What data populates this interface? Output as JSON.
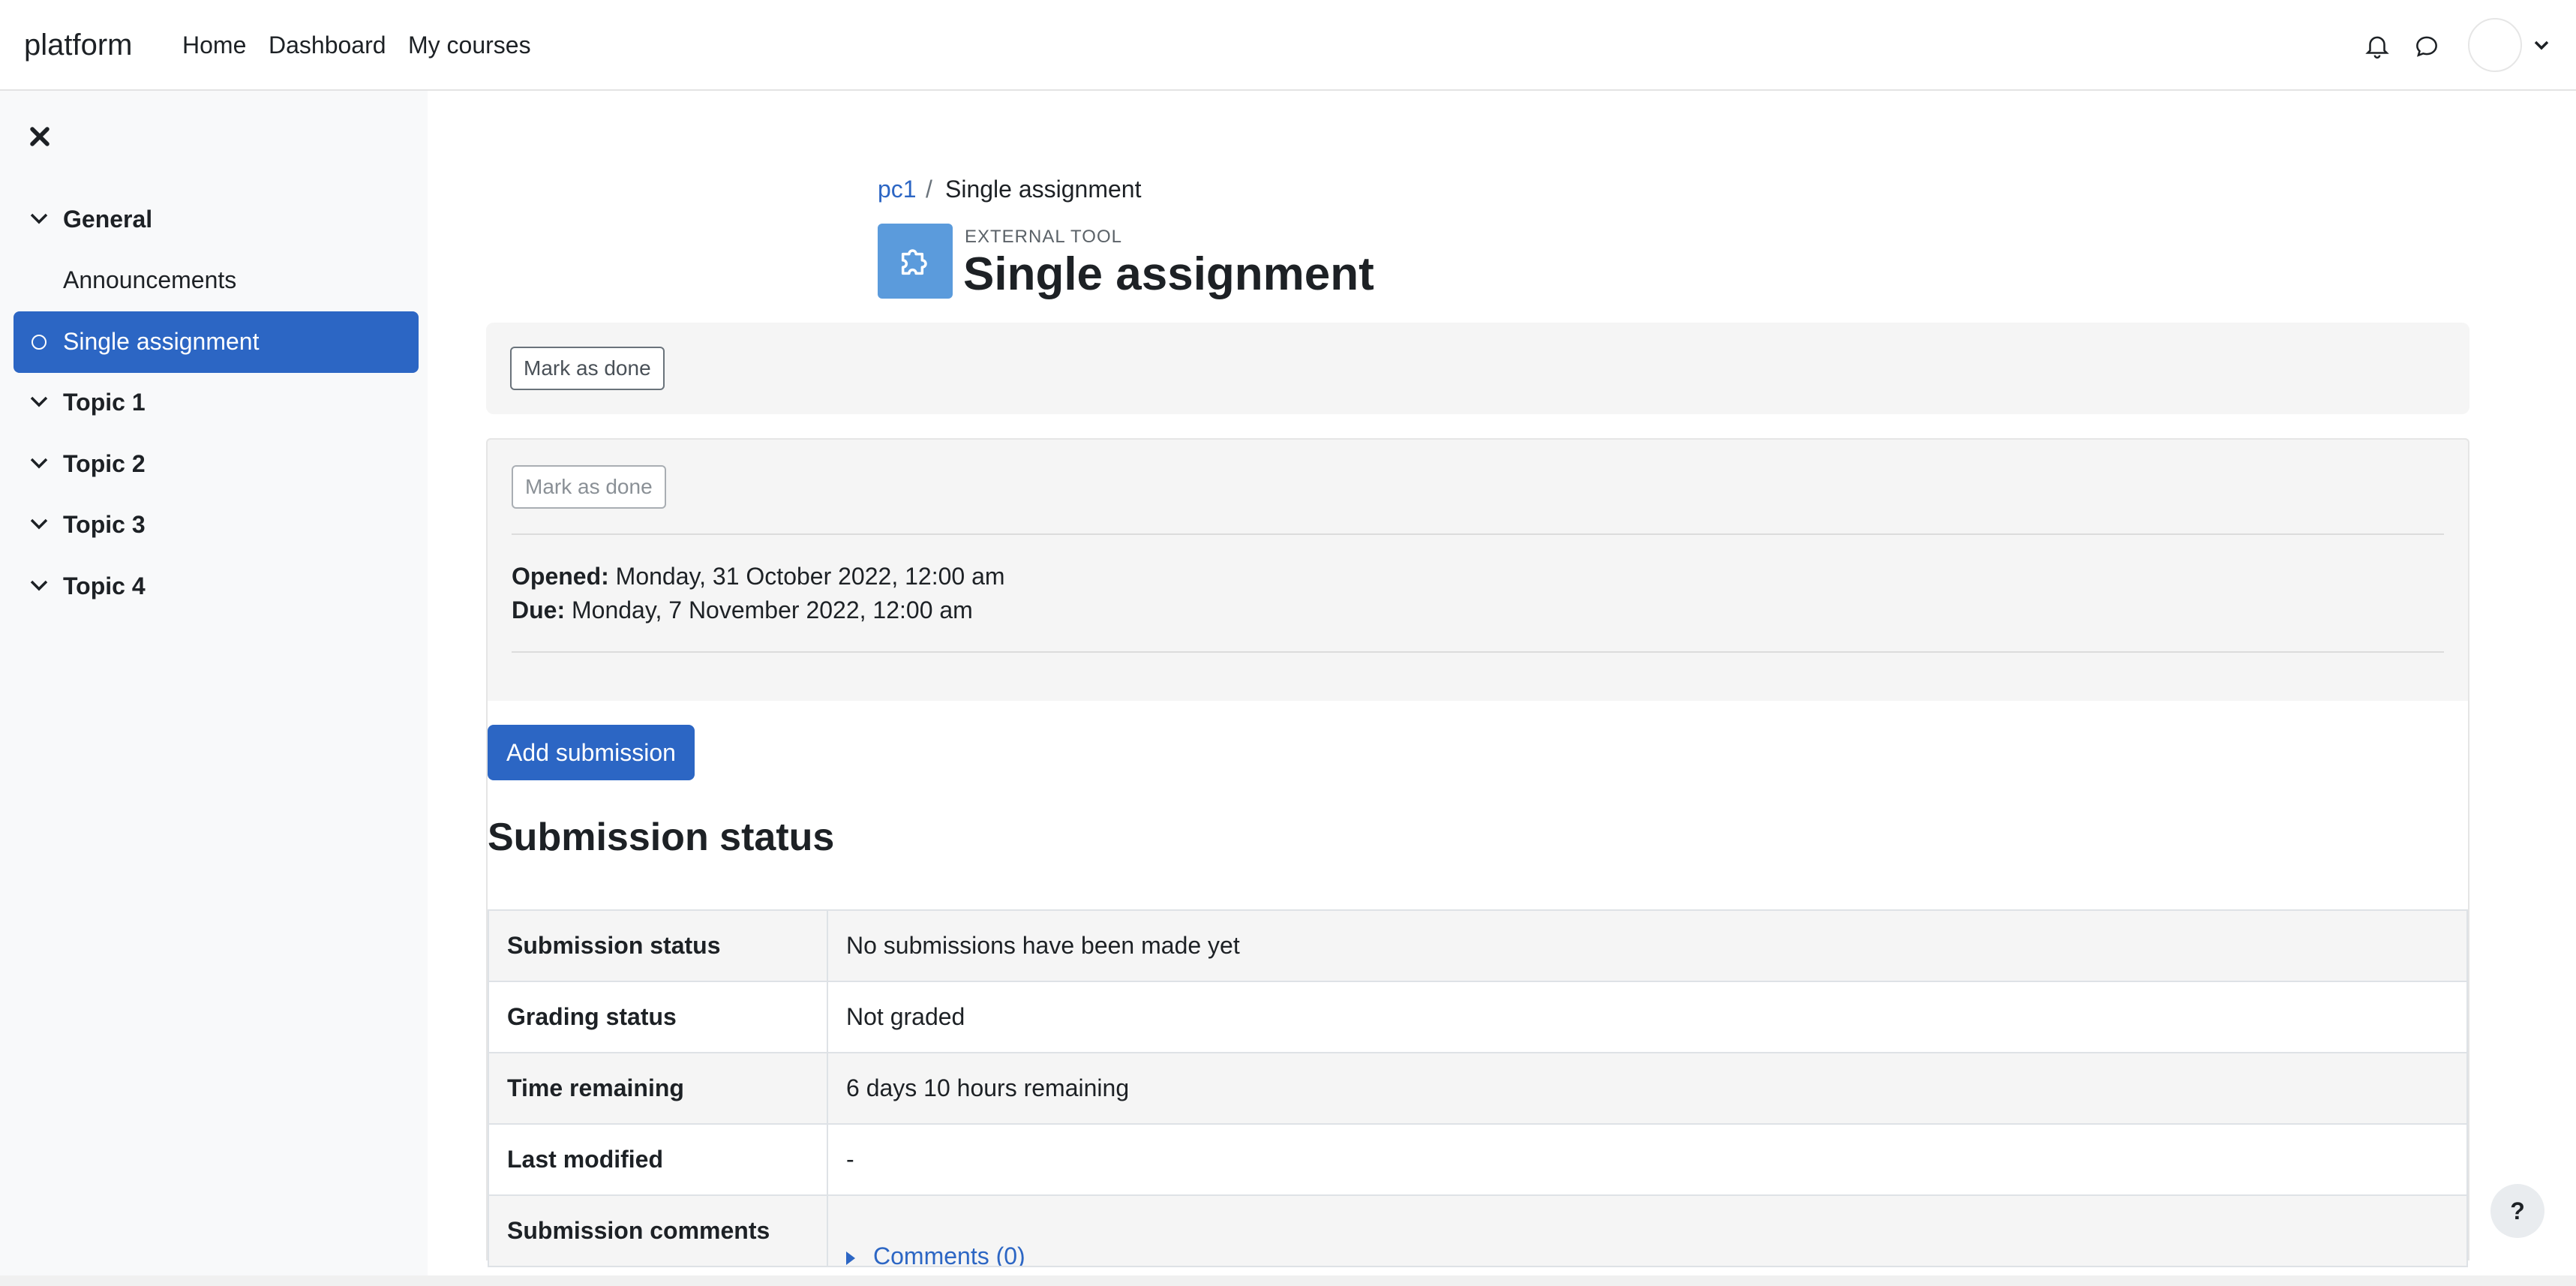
{
  "navbar": {
    "brand": "platform",
    "links": [
      "Home",
      "Dashboard",
      "My courses"
    ]
  },
  "drawer": {
    "sections": [
      {
        "label": "General",
        "items": [
          "Announcements",
          "Single assignment"
        ]
      },
      {
        "label": "Topic 1"
      },
      {
        "label": "Topic 2"
      },
      {
        "label": "Topic 3"
      },
      {
        "label": "Topic 4"
      }
    ],
    "active_item": "Single assignment"
  },
  "breadcrumb": {
    "course": "pc1",
    "separator": "/",
    "current": "Single assignment"
  },
  "header": {
    "module_type": "EXTERNAL TOOL",
    "title": "Single assignment"
  },
  "completion": {
    "mark_done_label": "Mark as done"
  },
  "dates": {
    "opened_label": "Opened:",
    "opened_value": "Monday, 31 October 2022, 12:00 am",
    "due_label": "Due:",
    "due_value": "Monday, 7 November 2022, 12:00 am"
  },
  "actions": {
    "add_submission": "Add submission"
  },
  "submission": {
    "heading": "Submission status",
    "rows": [
      {
        "key": "Submission status",
        "value": "No submissions have been made yet"
      },
      {
        "key": "Grading status",
        "value": "Not graded"
      },
      {
        "key": "Time remaining",
        "value": "6 days 10 hours remaining"
      },
      {
        "key": "Last modified",
        "value": "-"
      },
      {
        "key": "Submission comments",
        "value": "Comments (0)"
      }
    ]
  },
  "help": {
    "label": "?"
  },
  "colors": {
    "accent": "#2c66c4",
    "drawer_bg": "#f8f9fa",
    "module_icon": "#5b9bdc"
  }
}
